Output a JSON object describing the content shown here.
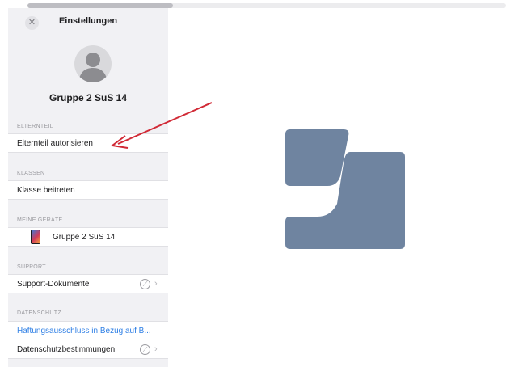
{
  "settings": {
    "title": "Einstellungen",
    "close_icon": "close-icon",
    "account_name": "Gruppe 2 SuS 14",
    "sections": {
      "elternteil": {
        "label": "ELTERNTEIL",
        "item": "Elternteil autorisieren"
      },
      "klassen": {
        "label": "KLASSEN",
        "item": "Klasse beitreten"
      },
      "geraete": {
        "label": "MEINE GERÄTE",
        "item": "Gruppe 2 SuS 14",
        "icon": "ipad-icon"
      },
      "support": {
        "label": "SUPPORT",
        "item": "Support-Dokumente",
        "icon": "compass-icon"
      },
      "datenschutz": {
        "label": "DATENSCHUTZ",
        "link": "Haftungsausschluss in Bezug auf B...",
        "item": "Datenschutzbestimmungen",
        "icon": "compass-icon"
      }
    }
  },
  "annotation": {
    "type": "red-arrow",
    "color": "#d12a36"
  },
  "logo": {
    "icon": "schoolwork-logo-icon",
    "color": "#6f84a0"
  },
  "colors": {
    "panel_bg": "#f1f1f4",
    "link": "#2e7fe5",
    "label_gray": "#9b9ba0"
  }
}
